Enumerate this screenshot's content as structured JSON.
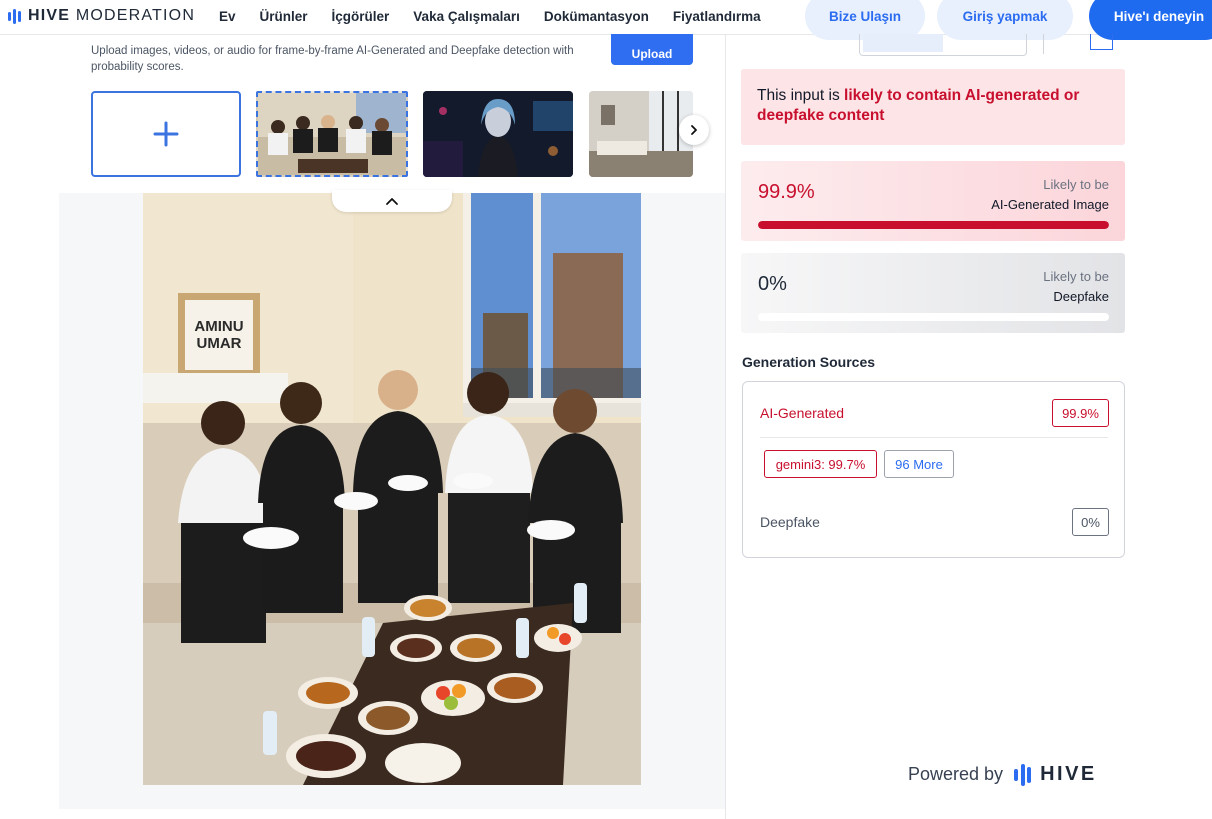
{
  "nav": {
    "logo_bold": "HIVE",
    "logo_light": "MODERATION",
    "links": [
      "Ev",
      "Ürünler",
      "İçgörüler",
      "Vaka Çalışmaları",
      "Dokümantasyon",
      "Fiyatlandırma"
    ],
    "contact_label": "Bize Ulaşın",
    "login_label": "Giriş yapmak",
    "try_label": "Hive'ı deneyin"
  },
  "upload": {
    "description": "Upload images, videos, or audio for frame-by-frame AI-Generated and Deepfake detection with probability scores.",
    "button_label": "Upload"
  },
  "thumbnails": [
    {
      "name": "thumb-group-dinner",
      "selected": true
    },
    {
      "name": "thumb-neon-portrait",
      "selected": false
    },
    {
      "name": "thumb-living-room",
      "selected": false
    }
  ],
  "photo": {
    "poster_line1": "AMINU",
    "poster_line2": "UMAR"
  },
  "result": {
    "verdict_prefix": "This input is ",
    "verdict_highlight": "likely to contain AI-generated or deepfake content",
    "ai": {
      "score": "99.9%",
      "fraction": 0.999,
      "caption1": "Likely to be",
      "caption2": "AI-Generated Image"
    },
    "deepfake": {
      "score": "0%",
      "fraction": 0,
      "caption1": "Likely to be",
      "caption2": "Deepfake"
    }
  },
  "sources": {
    "title": "Generation Sources",
    "ai_label": "AI-Generated",
    "ai_score": "99.9%",
    "chips": [
      "gemini3: 99.7%",
      "96 More"
    ],
    "deepfake_label": "Deepfake",
    "deepfake_score": "0%"
  },
  "footer": {
    "powered_by": "Powered by",
    "brand": "HIVE"
  },
  "colors": {
    "accent": "#2b6cf0",
    "danger": "#c8102e"
  }
}
